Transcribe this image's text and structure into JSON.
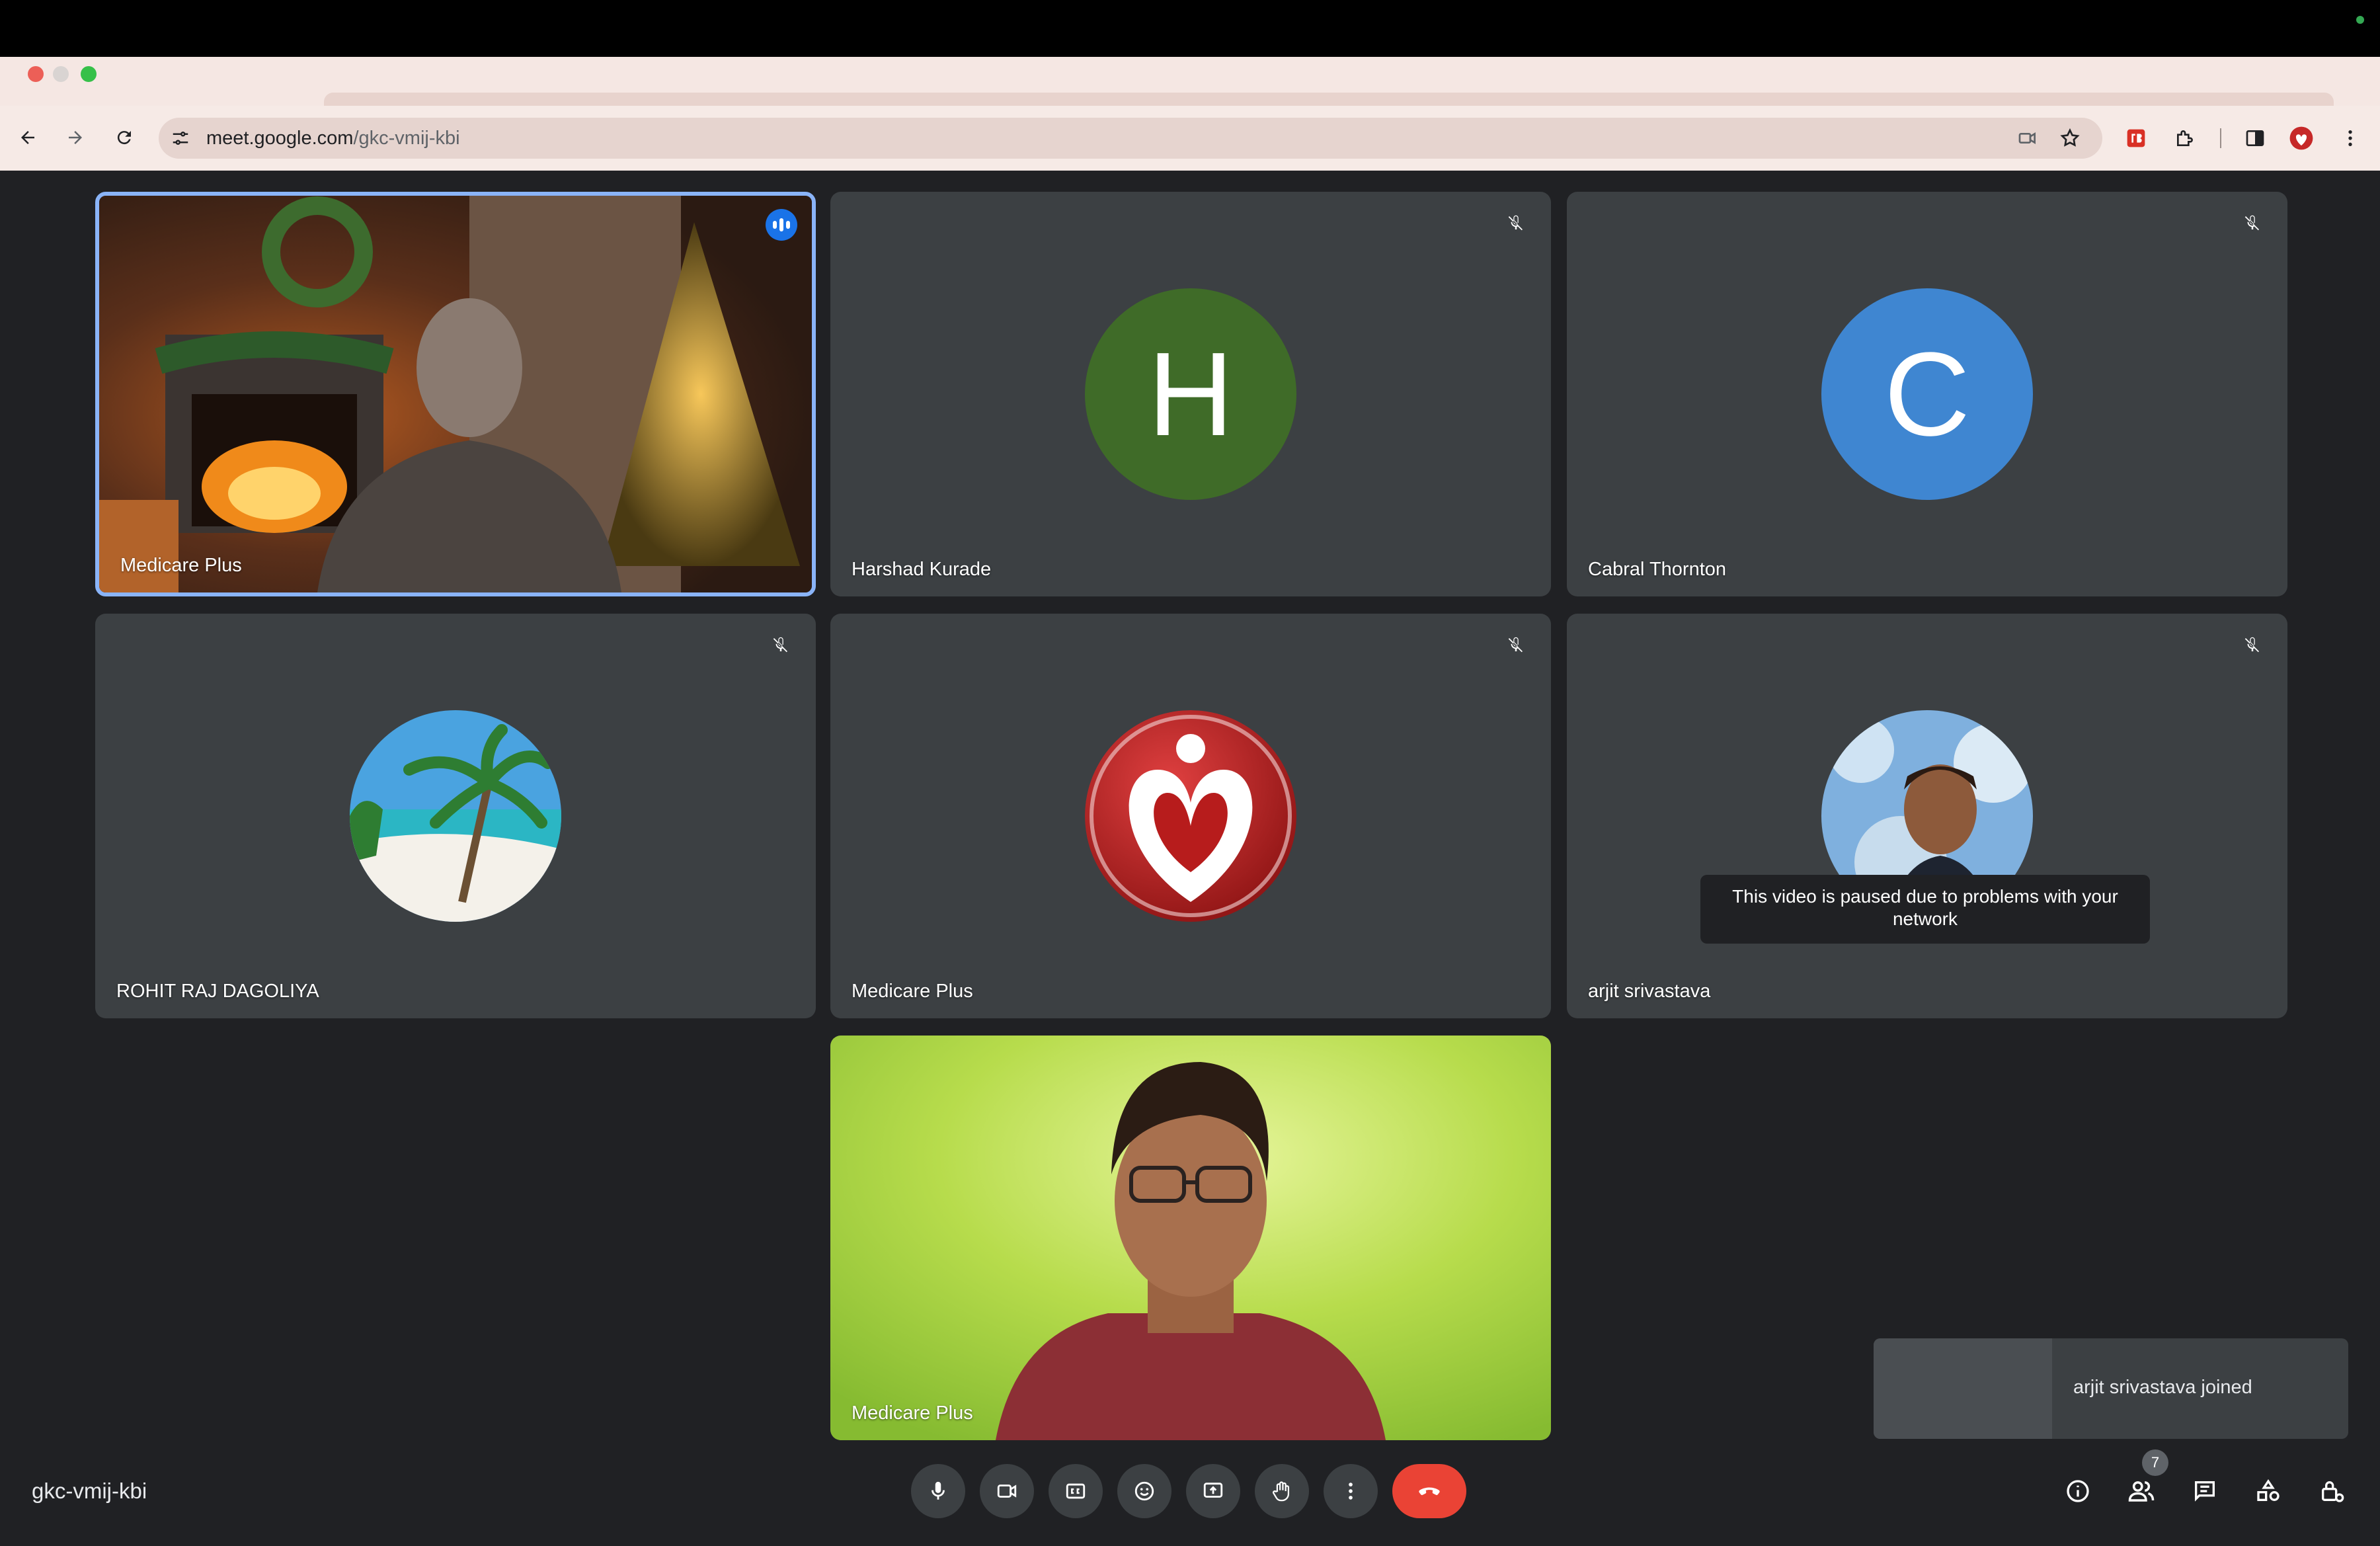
{
  "browser": {
    "url_host": "meet.google.com",
    "url_path": "/gkc-vmij-kbi"
  },
  "tiles": [
    {
      "name": "Medicare Plus",
      "speaking": true
    },
    {
      "name": "Harshad Kurade",
      "initial": "H",
      "color": "#3f6b28",
      "muted": true
    },
    {
      "name": "Cabral Thornton",
      "initial": "C",
      "color": "#3f86d1",
      "muted": true
    },
    {
      "name": "ROHIT RAJ DAGOLIYA",
      "muted": true
    },
    {
      "name": "Medicare Plus",
      "muted": true
    },
    {
      "name": "arjit srivastava",
      "muted": true,
      "notice": "This video is paused due to problems with your network"
    },
    {
      "name": "Medicare Plus"
    }
  ],
  "toast": {
    "text": "arjit srivastava joined"
  },
  "meeting": {
    "code": "gkc-vmij-kbi",
    "participant_count": "7"
  },
  "colors": {
    "background": "#202124",
    "tile": "#3c4043",
    "active_border": "#8ab4f8",
    "end_call": "#ea4335"
  }
}
